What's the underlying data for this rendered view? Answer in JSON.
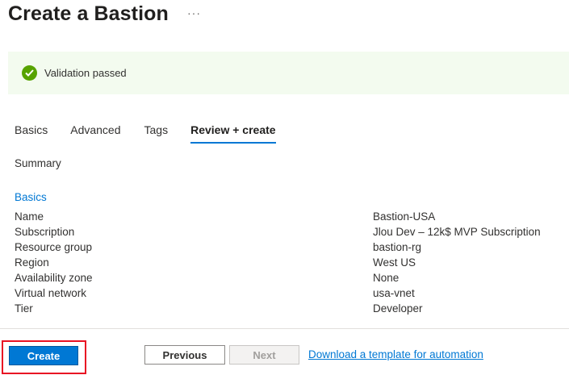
{
  "header": {
    "title": "Create a Bastion",
    "more_label": "···"
  },
  "banner": {
    "text": "Validation passed",
    "icon": "check-circle-icon",
    "color": "#57a300"
  },
  "tabs": [
    {
      "label": "Basics",
      "active": false
    },
    {
      "label": "Advanced",
      "active": false
    },
    {
      "label": "Tags",
      "active": false
    },
    {
      "label": "Review + create",
      "active": true
    }
  ],
  "summary": {
    "heading": "Summary"
  },
  "basics": {
    "heading": "Basics",
    "rows": [
      {
        "key": "Name",
        "value": "Bastion-USA"
      },
      {
        "key": "Subscription",
        "value": "Jlou Dev – 12k$ MVP Subscription"
      },
      {
        "key": "Resource group",
        "value": "bastion-rg"
      },
      {
        "key": "Region",
        "value": "West US"
      },
      {
        "key": "Availability zone",
        "value": "None"
      },
      {
        "key": "Virtual network",
        "value": "usa-vnet"
      },
      {
        "key": "Tier",
        "value": "Developer"
      }
    ]
  },
  "footer": {
    "create_label": "Create",
    "previous_label": "Previous",
    "next_label": "Next",
    "template_link": "Download a template for automation"
  },
  "colors": {
    "accent": "#0078d4",
    "highlight": "#e81123"
  }
}
